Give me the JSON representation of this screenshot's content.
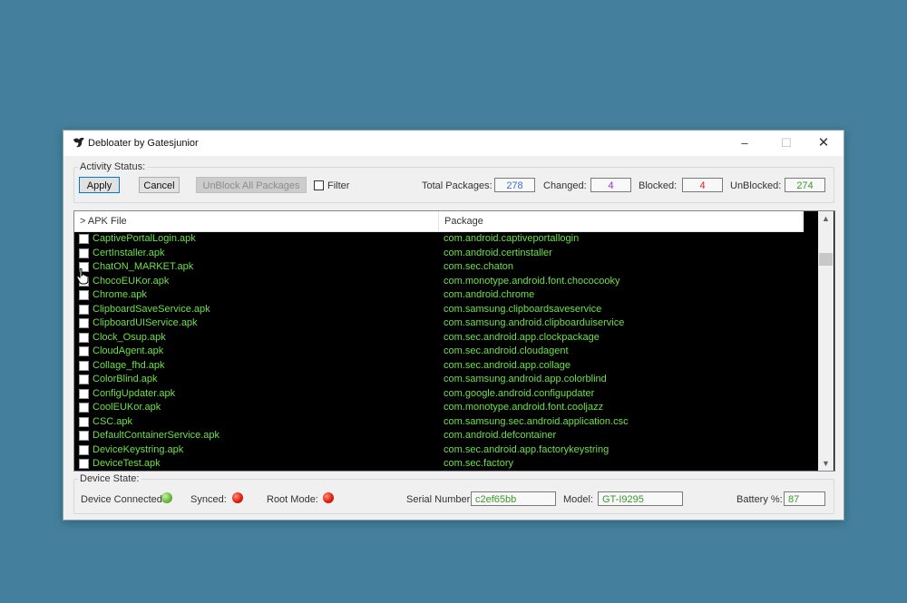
{
  "window": {
    "title": "Debloater by Gatesjunior"
  },
  "activity": {
    "group_label": "Activity Status:",
    "apply_label": "Apply",
    "cancel_label": "Cancel",
    "unblock_all_label": "UnBlock All Packages",
    "filter_label": "Filter",
    "total_label": "Total Packages:",
    "total_value": "278",
    "changed_label": "Changed:",
    "changed_value": "4",
    "blocked_label": "Blocked:",
    "blocked_value": "4",
    "unblocked_label": "UnBlocked:",
    "unblocked_value": "274"
  },
  "colors": {
    "total": "#3d6fd1",
    "changed": "#9b2fc9",
    "blocked": "#e02020",
    "unblocked": "#3a9a2a",
    "list_text": "#6ce04a"
  },
  "list": {
    "columns": [
      "> APK File",
      "Package"
    ],
    "rows": [
      {
        "apk": "CaptivePortalLogin.apk",
        "pkg": "com.android.captiveportallogin"
      },
      {
        "apk": "CertInstaller.apk",
        "pkg": "com.android.certinstaller"
      },
      {
        "apk": "ChatON_MARKET.apk",
        "pkg": "com.sec.chaton"
      },
      {
        "apk": "ChocoEUKor.apk",
        "pkg": "com.monotype.android.font.chococooky"
      },
      {
        "apk": "Chrome.apk",
        "pkg": "com.android.chrome"
      },
      {
        "apk": "ClipboardSaveService.apk",
        "pkg": "com.samsung.clipboardsaveservice"
      },
      {
        "apk": "ClipboardUIService.apk",
        "pkg": "com.samsung.android.clipboarduiservice"
      },
      {
        "apk": "Clock_Osup.apk",
        "pkg": "com.sec.android.app.clockpackage"
      },
      {
        "apk": "CloudAgent.apk",
        "pkg": "com.sec.android.cloudagent"
      },
      {
        "apk": "Collage_fhd.apk",
        "pkg": "com.sec.android.app.collage"
      },
      {
        "apk": "ColorBlind.apk",
        "pkg": "com.samsung.android.app.colorblind"
      },
      {
        "apk": "ConfigUpdater.apk",
        "pkg": "com.google.android.configupdater"
      },
      {
        "apk": "CoolEUKor.apk",
        "pkg": "com.monotype.android.font.cooljazz"
      },
      {
        "apk": "CSC.apk",
        "pkg": "com.samsung.sec.android.application.csc"
      },
      {
        "apk": "DefaultContainerService.apk",
        "pkg": "com.android.defcontainer"
      },
      {
        "apk": "DeviceKeystring.apk",
        "pkg": "com.sec.android.app.factorykeystring"
      },
      {
        "apk": "DeviceTest.apk",
        "pkg": "com.sec.factory"
      }
    ]
  },
  "device": {
    "group_label": "Device State:",
    "connected_label": "Device Connected:",
    "synced_label": "Synced:",
    "root_label": "Root Mode:",
    "serial_label": "Serial Number:",
    "serial_value": "c2ef65bb",
    "model_label": "Model:",
    "model_value": "GT-I9295",
    "battery_label": "Battery %:",
    "battery_value": "87"
  },
  "icons": {
    "app": "bird-icon",
    "minimize": "minimize-icon",
    "maximize": "maximize-icon",
    "close": "close-icon",
    "scroll_up": "chevron-up-icon",
    "scroll_down": "chevron-down-icon"
  }
}
